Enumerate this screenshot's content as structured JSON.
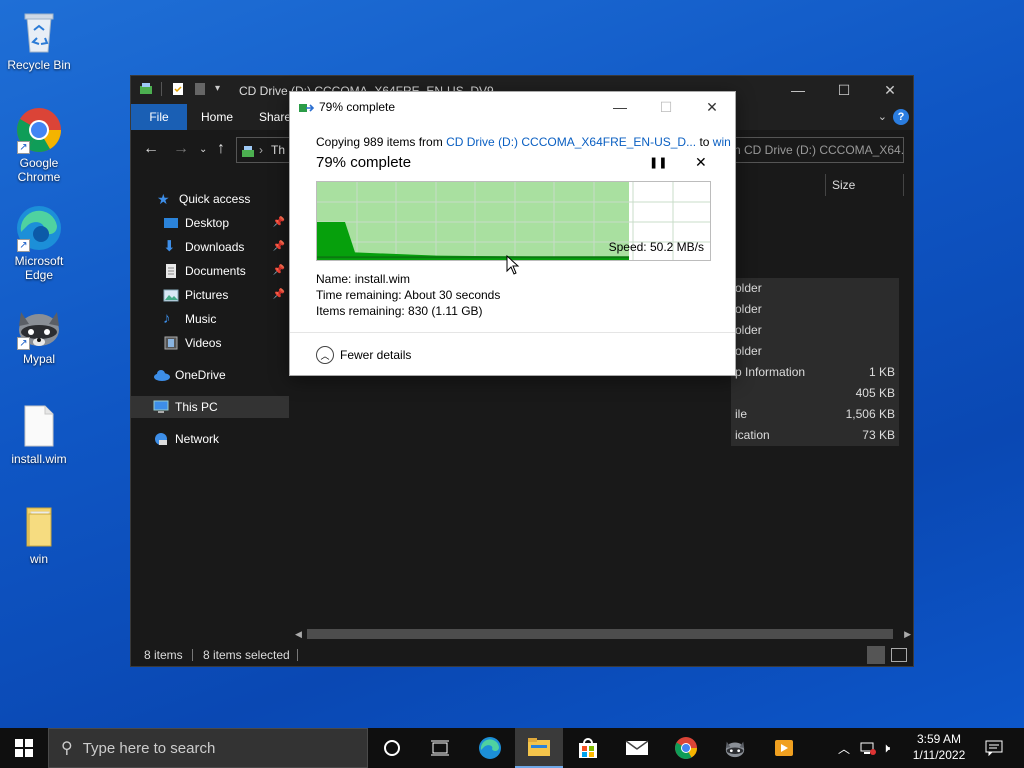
{
  "desktop": {
    "icons": [
      {
        "label": "Recycle Bin"
      },
      {
        "label": "Google Chrome"
      },
      {
        "label": "Microsoft Edge"
      },
      {
        "label": "Mypal"
      },
      {
        "label": "install.wim"
      },
      {
        "label": "win"
      }
    ]
  },
  "explorer": {
    "title": "CD Drive (D:) CCCOMA_X64FRE_EN-US_DV9",
    "ribbon": {
      "file": "File",
      "home": "Home",
      "share": "Share"
    },
    "address_partial": "Th",
    "search_placeholder": "n CD Drive (D:) CCCOMA_X64...",
    "nav": [
      {
        "label": "Quick access"
      },
      {
        "label": "Desktop"
      },
      {
        "label": "Downloads"
      },
      {
        "label": "Documents"
      },
      {
        "label": "Pictures"
      },
      {
        "label": "Music"
      },
      {
        "label": "Videos"
      },
      {
        "label": "OneDrive"
      },
      {
        "label": "This PC"
      },
      {
        "label": "Network"
      }
    ],
    "columns": {
      "size": "Size"
    },
    "rows": [
      {
        "type": "older",
        "size": ""
      },
      {
        "type": "older",
        "size": ""
      },
      {
        "type": "older",
        "size": ""
      },
      {
        "type": "older",
        "size": ""
      },
      {
        "type": "p Information",
        "size": "1 KB"
      },
      {
        "type": "",
        "size": "405 KB"
      },
      {
        "type": "ile",
        "size": "1,506 KB"
      },
      {
        "type": "ication",
        "size": "73 KB"
      }
    ],
    "status": {
      "items": "8 items",
      "selected": "8 items selected"
    }
  },
  "copy_dialog": {
    "title": "79% complete",
    "copying_prefix": "Copying 989 items from ",
    "source": "CD Drive (D:) CCCOMA_X64FRE_EN-US_D...",
    "to_word": " to ",
    "destination": "win",
    "percent_text": "79% complete",
    "speed": "Speed: 50.2 MB/s",
    "name_label": "Name:",
    "name_value": "install.wim",
    "time_label": "Time remaining:",
    "time_value": "About 30 seconds",
    "items_label": "Items remaining:",
    "items_value": "830 (1.11 GB)",
    "fewer_details": "Fewer details",
    "progress": 0.79
  },
  "taskbar": {
    "search_placeholder": "Type here to search",
    "time": "3:59 AM",
    "date": "1/11/2022"
  },
  "colors": {
    "accent": "#1a5fb4",
    "progress_fill": "#a9e0a0",
    "progress_line": "#06a00c",
    "link": "#0a5fc2"
  }
}
